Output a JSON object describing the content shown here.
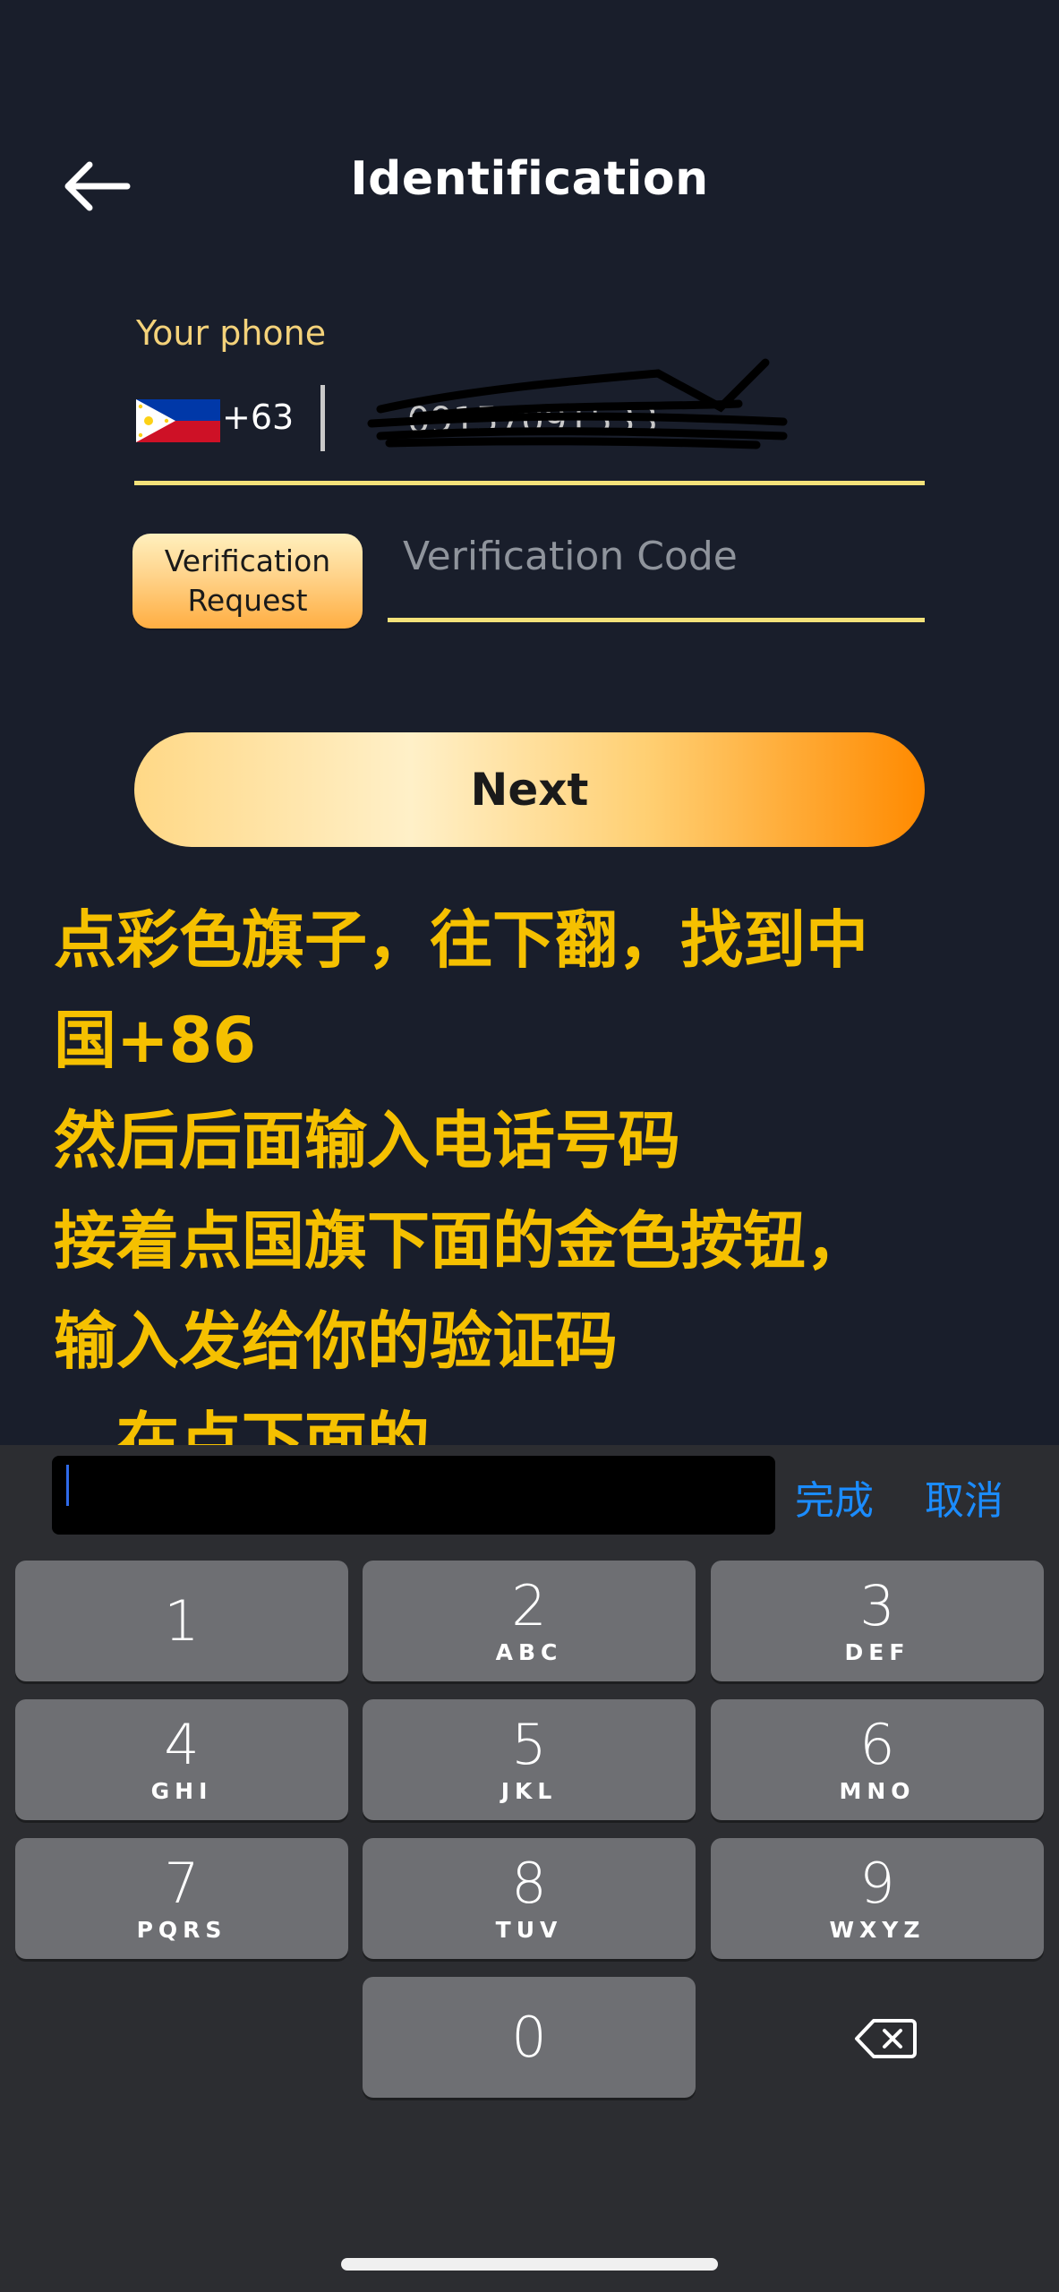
{
  "header": {
    "title": "Identification"
  },
  "phone": {
    "label": "Your phone",
    "country_code": "+63",
    "value": "09157091533"
  },
  "verification": {
    "request_line1": "Verification",
    "request_line2": "Request",
    "code_placeholder": "Verification Code"
  },
  "next_label": "Next",
  "instructions": {
    "text": "点彩色旗子，往下翻，找到中\n国+86\n然后后面输入电话号码\n接着点国旗下面的金色按钮，\n输入发给你的验证码\n，在点下面的\nNext"
  },
  "toolbar": {
    "done": "完成",
    "cancel": "取消"
  },
  "keypad": {
    "keys": [
      {
        "digit": "1",
        "letters": ""
      },
      {
        "digit": "2",
        "letters": "ABC"
      },
      {
        "digit": "3",
        "letters": "DEF"
      },
      {
        "digit": "4",
        "letters": "GHI"
      },
      {
        "digit": "5",
        "letters": "JKL"
      },
      {
        "digit": "6",
        "letters": "MNO"
      },
      {
        "digit": "7",
        "letters": "PQRS"
      },
      {
        "digit": "8",
        "letters": "TUV"
      },
      {
        "digit": "9",
        "letters": "WXYZ"
      },
      {
        "digit": "0",
        "letters": ""
      }
    ]
  },
  "colors": {
    "background": "#191e2b",
    "accent_gold": "#f5c000",
    "underline": "#f4e27a",
    "ios_blue": "#1b8cff"
  },
  "icons": {
    "back": "arrow-left-icon",
    "flag": "philippines-flag-icon",
    "backspace": "backspace-icon"
  }
}
